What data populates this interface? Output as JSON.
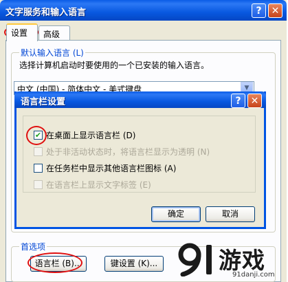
{
  "window": {
    "title": "文字服务和输入语言",
    "help_glyph": "?",
    "close_glyph": "✕"
  },
  "tabs": [
    {
      "label": "设置"
    },
    {
      "label": "高级"
    }
  ],
  "default_language": {
    "group_title": "默认输入语言 (L)",
    "description": "选择计算机启动时要使用的一个已安装的输入语言。",
    "selected": "中文 (中国) - 简体中文 - 美式键盘"
  },
  "preferences": {
    "group_title": "首选项",
    "language_bar_button": "语言栏 (B)...",
    "key_settings_button": "键设置 (K)..."
  },
  "dialog": {
    "title": "语言栏设置",
    "options": [
      {
        "label": "在桌面上显示语言栏 (D)",
        "checked": true,
        "disabled": false
      },
      {
        "label": "处于非活动状态时，将语言栏显示为透明 (N)",
        "checked": false,
        "disabled": true
      },
      {
        "label": "在任务栏中显示其他语言栏图标 (A)",
        "checked": false,
        "disabled": false
      },
      {
        "label": "在语言栏上显示文字标签 (E)",
        "checked": false,
        "disabled": true
      }
    ],
    "ok_button": "确定",
    "cancel_button": "取消"
  },
  "watermark": {
    "logo_text": "9",
    "brand": "游戏",
    "url": "91danji.com"
  },
  "colors": {
    "title_blue": "#0a5ce6",
    "accent_group": "#0046d5",
    "annotation_red": "#e01010",
    "check_green": "#21a121"
  }
}
